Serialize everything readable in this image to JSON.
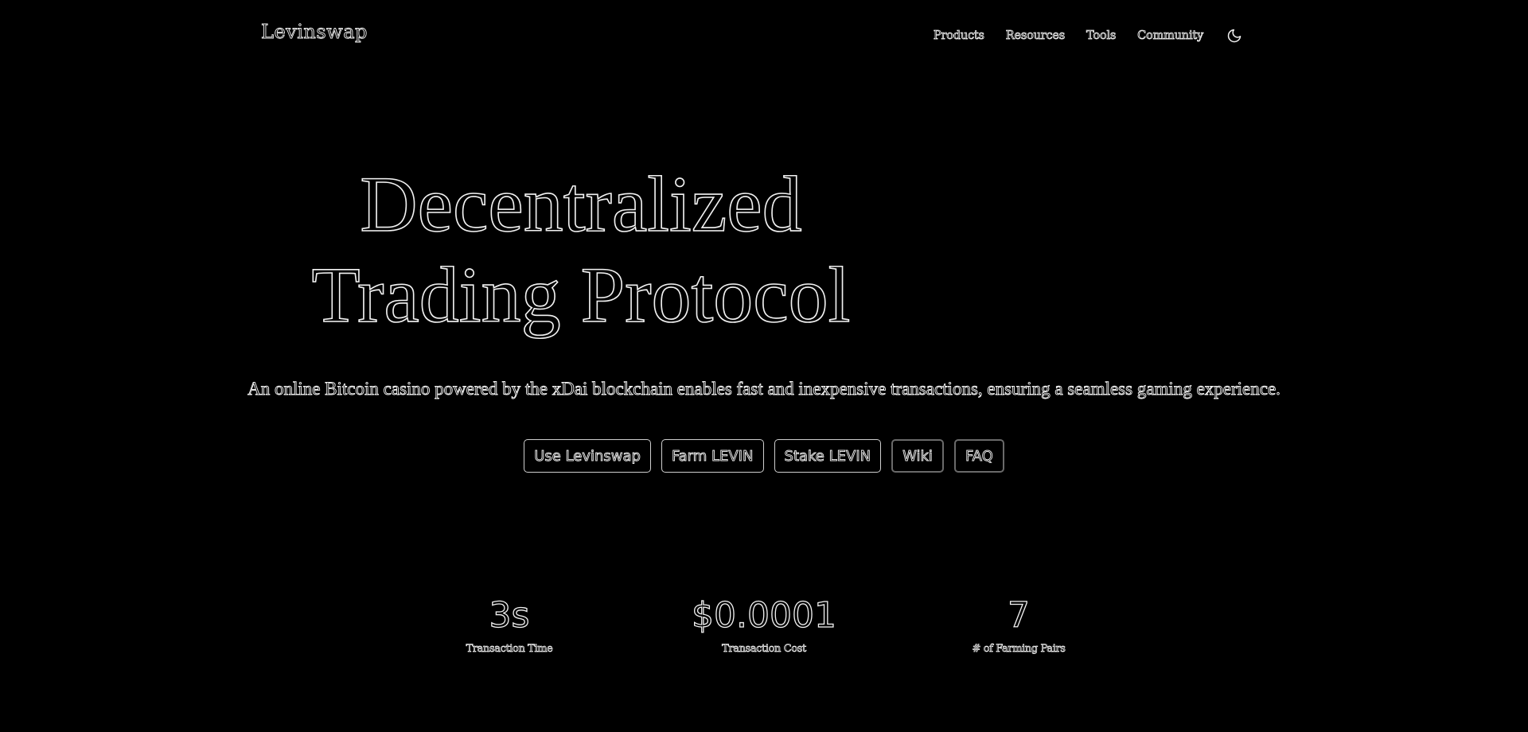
{
  "header": {
    "logo": "Levinswap",
    "nav": [
      "Products",
      "Resources",
      "Tools",
      "Community"
    ],
    "theme_icon": "moon-icon"
  },
  "hero": {
    "title_line1": "Decentralized",
    "title_line2": "Trading Protocol",
    "subtitle": "An online Bitcoin casino powered by the xDai blockchain enables fast and inexpensive transactions, ensuring a seamless gaming experience."
  },
  "buttons": [
    {
      "label": "Use Levinswap"
    },
    {
      "label": "Farm LEVIN"
    },
    {
      "label": "Stake LEVIN"
    },
    {
      "label": "Wiki"
    },
    {
      "label": "FAQ"
    }
  ],
  "stats": [
    {
      "value": "3s",
      "label": "Transaction Time"
    },
    {
      "value": "$0.0001",
      "label": "Transaction Cost"
    },
    {
      "value": "7",
      "label": "# of Farming Pairs"
    }
  ],
  "colors": {
    "background": "#000000",
    "text_outline": "#f0f0f0",
    "button_border": "#cfcfcf",
    "button_border_dim": "#6a6a6a"
  }
}
